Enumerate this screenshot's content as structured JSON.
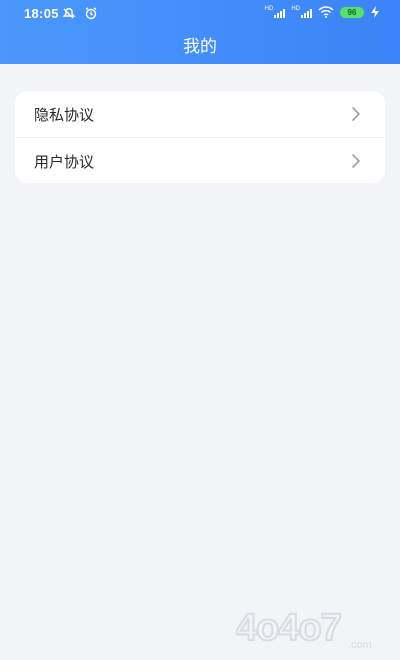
{
  "status_bar": {
    "time": "18:05",
    "battery": "96",
    "network_1": "HD",
    "network_2": "HD"
  },
  "header": {
    "title": "我的"
  },
  "menu": {
    "items": [
      {
        "label": "隐私协议"
      },
      {
        "label": "用户协议"
      }
    ]
  },
  "watermark": {
    "text": "4o4o7",
    "suffix": ".com"
  },
  "colors": {
    "header_start": "#4a98fb",
    "header_end": "#3c83f7",
    "page_bg": "#f3f4f7",
    "card_bg": "#ffffff"
  }
}
